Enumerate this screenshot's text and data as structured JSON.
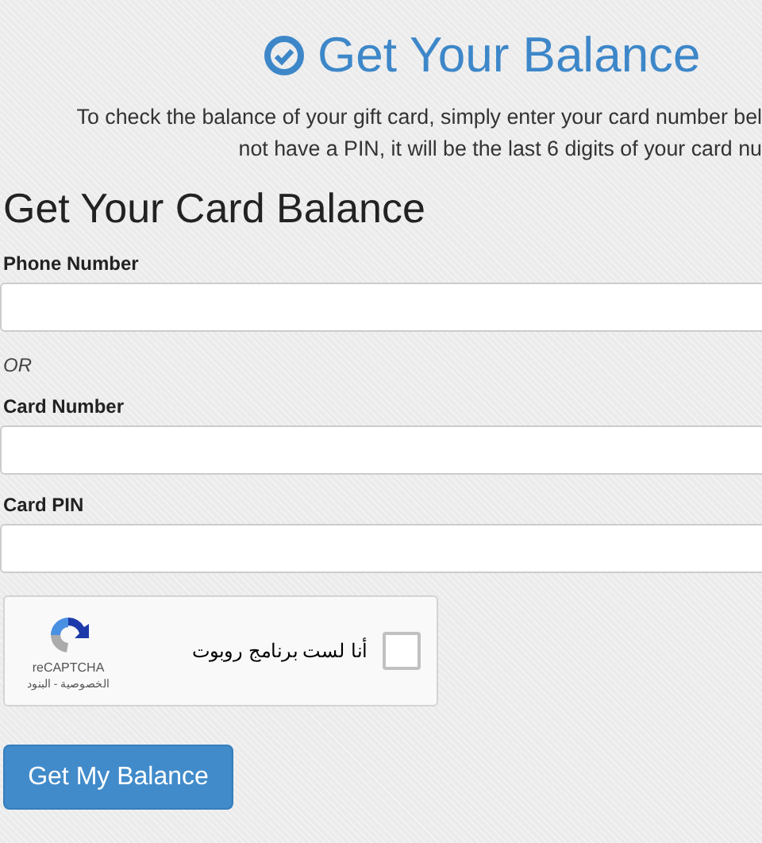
{
  "title": "Get Your Balance",
  "intro_lines": [
    "To check the balance of your gift card, simply enter your card number bel",
    "not have a PIN, it will be the last 6 digits of your card nu"
  ],
  "form": {
    "heading": "Get Your Card Balance",
    "fields": [
      {
        "kind": "field",
        "label": "Phone Number"
      },
      {
        "kind": "separator",
        "label": "OR"
      },
      {
        "kind": "field",
        "label": "Card Number"
      },
      {
        "kind": "field",
        "label": "Card PIN"
      }
    ]
  },
  "captcha": {
    "label": "أنا لست برنامج روبوت",
    "checked": false,
    "brand": "reCAPTCHA",
    "links": "الخصوصية - البنود"
  },
  "submit": "Get My Balance"
}
